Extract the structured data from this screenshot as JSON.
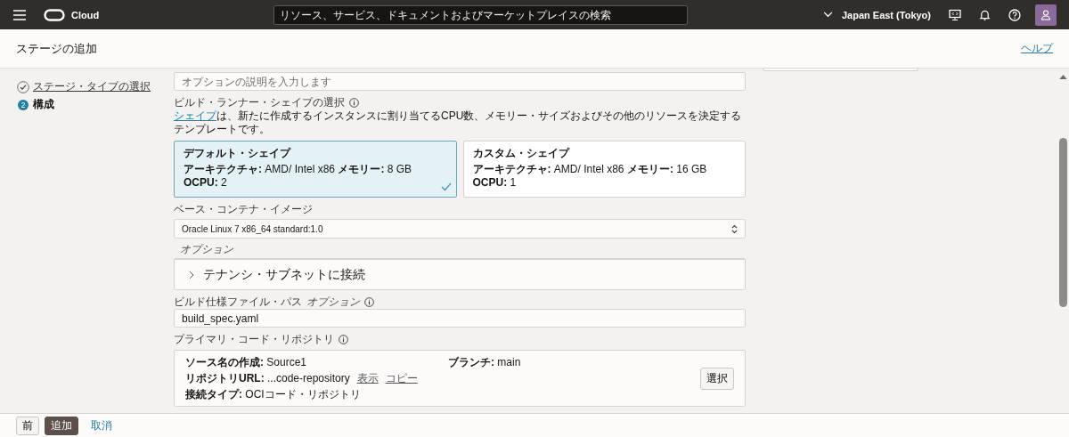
{
  "header": {
    "brand": "Cloud",
    "search_placeholder": "リソース、サービス、ドキュメントおよびマーケットプレイスの検索",
    "region": "Japan East (Tokyo)"
  },
  "page": {
    "title": "ステージの追加",
    "help_link": "ヘルプ"
  },
  "steps": [
    {
      "label": "ステージ・タイプの選択",
      "completed": true,
      "selected": false
    },
    {
      "number": "2",
      "label": "構成",
      "completed": false,
      "selected": true
    }
  ],
  "form": {
    "description": {
      "placeholder": "オプションの説明を入力します"
    },
    "shape": {
      "label": "ビルド・ランナー・シェイプの選択",
      "help_link": "シェイプ",
      "help_text": "は、新たに作成するインスタンスに割り当てるCPU数、メモリー・サイズおよびその他のリソースを決定するテンプレートです。",
      "options": [
        {
          "title": "デフォルト・シェイプ",
          "lines": [
            "**アーキテクチャ:** AMD/ Intel x86 **メモリー:** 8 GB",
            "**OCPU:** 2"
          ],
          "selected": true
        },
        {
          "title": "カスタム・シェイプ",
          "lines": [
            "**アーキテクチャ:** AMD/ Intel x86 **メモリー:** 16 GB",
            "**OCPU:** 1"
          ],
          "selected": false
        }
      ]
    },
    "base_image": {
      "label": "ベース・コンテナ・イメージ",
      "value": "Oracle Linux 7 x86_64 standard:1.0"
    },
    "optional_section": {
      "caption": "オプション",
      "title": "テナンシ・サブネットに接続",
      "expanded": false
    },
    "build_spec": {
      "label": "ビルド仕様ファイル・パス",
      "optional": "オプション",
      "value": "build_spec.yaml"
    },
    "repository": {
      "label": "プライマリ・コード・リポジトリ",
      "source": "**ソース名の作成:** Source1",
      "branch": "**ブランチ:** main",
      "url": "**リポジトリURL:** ...code-repository",
      "view_link": "表示",
      "copy_link": "コピー",
      "connection": "**接続タイプ:** OCIコード・リポジトリ",
      "select_button": "選択"
    }
  },
  "footer": {
    "buttons": [
      {
        "label": "前",
        "kind": "secondary"
      },
      {
        "label": "追加",
        "kind": "primary"
      },
      {
        "label": "取消",
        "kind": "link"
      }
    ]
  }
}
